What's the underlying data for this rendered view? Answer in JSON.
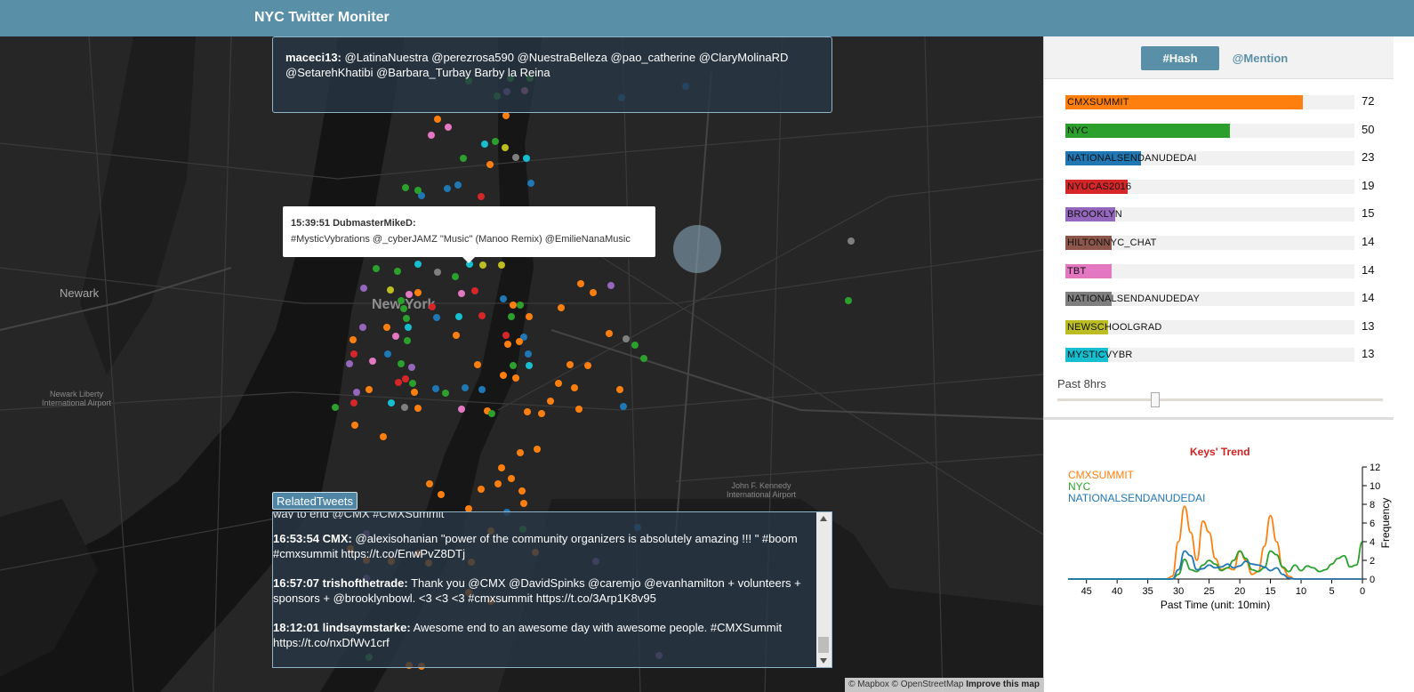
{
  "header": {
    "title": "NYC Twitter Moniter"
  },
  "map": {
    "labels": {
      "newark": "Newark",
      "new_york": "New York",
      "newark_airport": "Newark Liberty\nInternational Airport",
      "jfk": "John F. Kennedy\nInternational Airport"
    },
    "dot_colors": {
      "orange": "#ff7f0e",
      "green": "#2ca02c",
      "blue": "#1f77b4",
      "red": "#d62728",
      "purple": "#9467bd",
      "pink": "#e377c2",
      "gray": "#7f7f7f",
      "olive": "#bcbd22",
      "cyan": "#17becf"
    },
    "attribution": {
      "text": "© Mapbox © OpenStreetMap",
      "link": "Improve this map"
    }
  },
  "top_tweet": {
    "user": "maceci13:",
    "text": "@LatinaNuestra @perezrosa590 @NuestraBelleza @pao_catherine @ClaryMolinaRD @SetarehKhatibi @Barbara_Turbay Barby la Reina"
  },
  "popup": {
    "header": "15:39:51 DubmasterMikeD:",
    "text": "#MysticVybrations @_cyberJAMZ \"Music\" (Manoo Remix) @EmilieNanaMusic"
  },
  "related": {
    "button_label": "RelatedTweets",
    "cut_text": "way to end @CMX #CMXSummit",
    "tweets": [
      {
        "head": "16:53:54 CMX:",
        "text": "@alexisohanian \"power of the community organizers is absolutely amazing !!! \" #boom #cmxsummit https://t.co/EnwPvZ8DTj"
      },
      {
        "head": "16:57:07 trishofthetrade:",
        "text": "Thank you @CMX @DavidSpinks @caremjo @evanhamilton + volunteers + sponsors + @brooklynbowl. <3 <3 <3 #cmxsummit https://t.co/3Arp1K8v95"
      },
      {
        "head": "18:12:01 lindsaymstarke:",
        "text": "Awesome end to an awesome day with awesome people. #CMXSummit https://t.co/nxDfWv1crf"
      }
    ]
  },
  "side": {
    "tabs": {
      "hash": "#Hash",
      "mention": "@Mention",
      "active": "hash"
    },
    "bars": [
      {
        "label": "CMXSUMMIT",
        "count": 72,
        "color": "#ff7f0e"
      },
      {
        "label": "NYC",
        "count": 50,
        "color": "#2ca02c"
      },
      {
        "label": "NATIONALSENDANUDEDAI",
        "count": 23,
        "color": "#1f77b4"
      },
      {
        "label": "NYUCAS2016",
        "count": 19,
        "color": "#d62728"
      },
      {
        "label": "BROOKLYN",
        "count": 15,
        "color": "#9467bd"
      },
      {
        "label": "HILTONNYC_CHAT",
        "count": 14,
        "color": "#8c564b"
      },
      {
        "label": "TBT",
        "count": 14,
        "color": "#e377c2"
      },
      {
        "label": "NATIONALSENDANUDEDAY",
        "count": 14,
        "color": "#7f7f7f"
      },
      {
        "label": "NEWSCHOOLGRAD",
        "count": 13,
        "color": "#bcbd22"
      },
      {
        "label": "MYSTICVYBR",
        "count": 13,
        "color": "#17becf"
      }
    ],
    "time_window": "Past 8hrs",
    "slider_fraction": 0.3
  },
  "chart_data": {
    "type": "line",
    "title": "Keys' Trend",
    "xlabel": "Past Time (unit: 10min)",
    "ylabel": "Frequency",
    "xlim": [
      48,
      0
    ],
    "ylim": [
      0,
      12
    ],
    "xticks": [
      45,
      40,
      35,
      30,
      25,
      20,
      15,
      10,
      5,
      0
    ],
    "yticks": [
      0,
      2,
      4,
      6,
      8,
      10,
      12
    ],
    "x": [
      48,
      47,
      46,
      45,
      44,
      43,
      42,
      41,
      40,
      39,
      38,
      37,
      36,
      35,
      34,
      33,
      32,
      31,
      30,
      29,
      28,
      27,
      26,
      25,
      24,
      23,
      22,
      21,
      20,
      19,
      18,
      17,
      16,
      15,
      14,
      13,
      12,
      11,
      10,
      9,
      8,
      7,
      6,
      5,
      4,
      3,
      2,
      1,
      0
    ],
    "series": [
      {
        "name": "CMXSUMMIT",
        "color": "#ff7f0e",
        "values": [
          0,
          0,
          0,
          0,
          0,
          0,
          0,
          0,
          0,
          0,
          0,
          0,
          0,
          0,
          0,
          0,
          0,
          0.3,
          4,
          7.8,
          5,
          2,
          6.2,
          5,
          2.2,
          1,
          1.2,
          1,
          3,
          2,
          0.5,
          0.8,
          3.5,
          6.8,
          4,
          1.2,
          0.3,
          0,
          0,
          0,
          0,
          0,
          0,
          0,
          0,
          0,
          0,
          0,
          0
        ]
      },
      {
        "name": "NYC",
        "color": "#2ca02c",
        "values": [
          0,
          0,
          0,
          0,
          0,
          0,
          0,
          0,
          0,
          0,
          0,
          0,
          0,
          0,
          0,
          0,
          0,
          0,
          0.5,
          2.1,
          1,
          0.8,
          1.5,
          2,
          1.6,
          0.9,
          1.2,
          2,
          3,
          2.2,
          1,
          0.8,
          1.2,
          3,
          2.6,
          1.3,
          0.8,
          1.5,
          0.9,
          1.4,
          1.2,
          0.8,
          1,
          1.6,
          2.2,
          2.5,
          1.3,
          1.5,
          4
        ]
      },
      {
        "name": "NATIONALSENDANUDEDAI",
        "color": "#1f77b4",
        "values": [
          0,
          0,
          0,
          0,
          0,
          0,
          0,
          0,
          0,
          0,
          0,
          0,
          0,
          0,
          0,
          0,
          0,
          0,
          1,
          3,
          2.5,
          1,
          1.1,
          1.5,
          1.2,
          1.3,
          1.6,
          1.2,
          1.4,
          1.9,
          1.6,
          1.5,
          1.3,
          0.9,
          1.2,
          0.5,
          0.1,
          0,
          0,
          0,
          0,
          0,
          0,
          0,
          0,
          0,
          0,
          0,
          0
        ]
      }
    ]
  }
}
